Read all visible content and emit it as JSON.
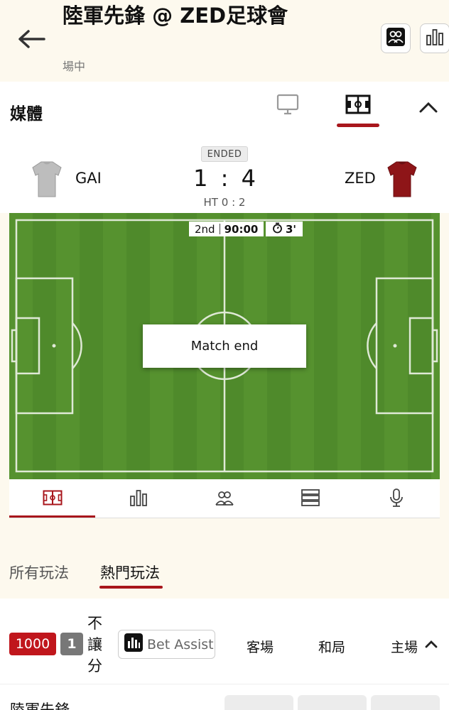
{
  "header": {
    "title": "陸軍先鋒 @ ZED足球會",
    "status": "場中"
  },
  "media": {
    "title": "媒體"
  },
  "match": {
    "status": "ENDED",
    "home_team": "GAI",
    "away_team": "ZED",
    "home_score": "1",
    "separator": ":",
    "away_score": "4",
    "ht_label": "HT",
    "ht_score": "0 : 2",
    "period": "2nd",
    "clock": "90:00",
    "added_time": "3'",
    "overlay": "Match end",
    "colors": {
      "home_shirt": "#bdbdbd",
      "away_shirt": "#8e1518",
      "pitch": "#4f8a2b",
      "accent": "#a8161c"
    }
  },
  "filters": [
    {
      "label": "所有玩法",
      "active": false
    },
    {
      "label": "熱門玩法",
      "active": true
    }
  ],
  "market": {
    "limit": "1000",
    "count": "1",
    "name_vertical": [
      "不",
      "讓",
      "分"
    ],
    "bet_assist": "Bet Assist",
    "columns": [
      "客場",
      "和局",
      "主場"
    ]
  },
  "rows": [
    {
      "name": "陸軍先鋒"
    }
  ],
  "icons": [
    "back-arrow-icon",
    "lineup-icon",
    "stats-icon",
    "tv-icon",
    "pitch-icon",
    "chevron-up-icon",
    "list-icon",
    "microphone-icon",
    "stopwatch-icon"
  ]
}
